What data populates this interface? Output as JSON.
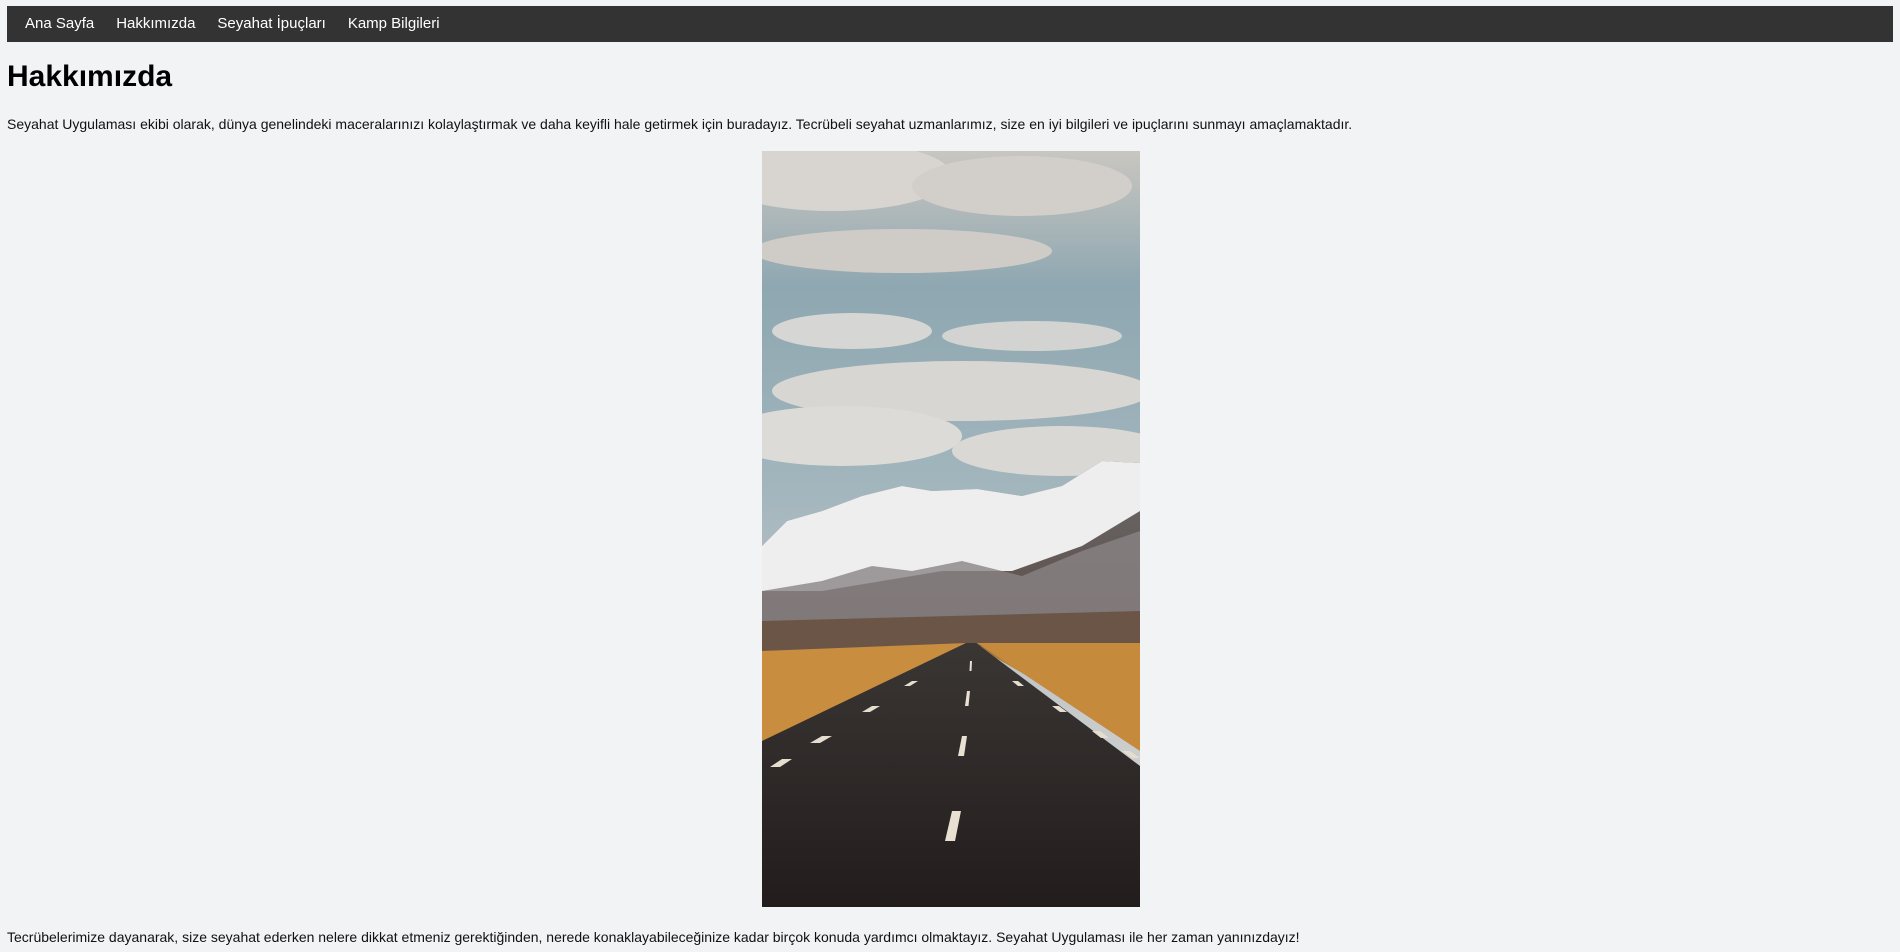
{
  "nav": {
    "items": [
      {
        "label": "Ana Sayfa"
      },
      {
        "label": "Hakkımızda"
      },
      {
        "label": "Seyahat İpuçları"
      },
      {
        "label": "Kamp Bilgileri"
      }
    ]
  },
  "main": {
    "title": "Hakkımızda",
    "intro": "Seyahat Uygulaması ekibi olarak, dünya genelindeki maceralarınızı kolaylaştırmak ve daha keyifli hale getirmek için buradayız. Tecrübeli seyahat uzmanlarımız, size en iyi bilgileri ve ipuçlarını sunmayı amaçlamaktadır.",
    "outro": "Tecrübelerimize dayanarak, size seyahat ederken nelere dikkat etmeniz gerektiğinden, nerede konaklayabileceğinize kadar birçok konuda yardımcı olmaktayız. Seyahat Uygulaması ile her zaman yanınızdayız!"
  },
  "colors": {
    "nav_background": "#333333",
    "page_background": "#f2f3f5",
    "text": "#111111"
  }
}
